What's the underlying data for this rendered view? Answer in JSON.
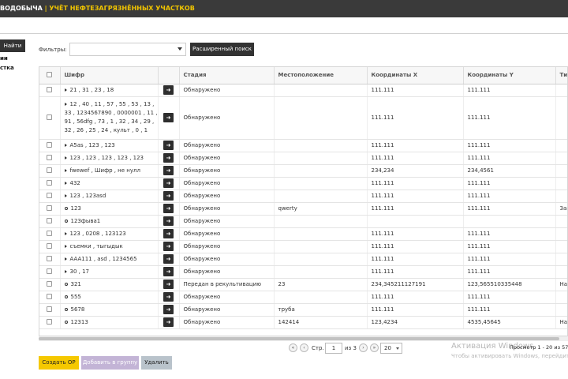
{
  "header": {
    "brand": "ВОДОБЫЧА",
    "separator": "|",
    "module_title": "УЧЁТ НЕФТЕЗАГРЯЗНЁННЫХ УЧАСТКОВ"
  },
  "sidebar": {
    "find_label": "Найти",
    "links": [
      "ии",
      "стка"
    ]
  },
  "filters": {
    "label": "Фильтры:",
    "value": "",
    "advanced_label": "Расширенный поиск"
  },
  "table": {
    "columns": [
      "Шифр",
      "Стадия",
      "Местоположение",
      "Координаты X",
      "Координаты Y",
      "Ти"
    ],
    "rows": [
      {
        "marker": "expand",
        "code": "21 , 31 , 23 , 18",
        "stage": "Обнаружено",
        "location": "",
        "x": "111.111",
        "y": "111.111",
        "type": "",
        "tall": false
      },
      {
        "marker": "expand",
        "code": "12 , 40 , 11 , 57 , 55 , 53 , 13 , 33 , 1234567890 , 0000001 , 11 , 91 , 56dfg , 73 , 1 , 32 , 34 , 29 , 32 , 26 , 25 , 24 , культ , 0 , 1",
        "stage": "Обнаружено",
        "location": "",
        "x": "111.111",
        "y": "111.111",
        "type": "",
        "tall": true
      },
      {
        "marker": "expand",
        "code": "A5as , 123 , 123",
        "stage": "Обнаружено",
        "location": "",
        "x": "111.111",
        "y": "111.111",
        "type": "",
        "tall": false
      },
      {
        "marker": "expand",
        "code": "123 , 123 , 123 , 123 , 123",
        "stage": "Обнаружено",
        "location": "",
        "x": "111.111",
        "y": "111.111",
        "type": "",
        "tall": false
      },
      {
        "marker": "expand",
        "code": "fwewef , Шифр , не нулл",
        "stage": "Обнаружено",
        "location": "",
        "x": "234,234",
        "y": "234,4561",
        "type": "",
        "tall": false
      },
      {
        "marker": "expand",
        "code": "432",
        "stage": "Обнаружено",
        "location": "",
        "x": "111.111",
        "y": "111.111",
        "type": "",
        "tall": false
      },
      {
        "marker": "expand",
        "code": "123 , 123asd",
        "stage": "Обнаружено",
        "location": "",
        "x": "111.111",
        "y": "111.111",
        "type": "",
        "tall": false
      },
      {
        "marker": "dot",
        "code": "123",
        "stage": "Обнаружено",
        "location": "qwerty",
        "x": "111.111",
        "y": "111.111",
        "type": "Загр",
        "tall": false
      },
      {
        "marker": "dot",
        "code": "123фыва1",
        "stage": "Обнаружено",
        "location": "",
        "x": "",
        "y": "",
        "type": "",
        "tall": false
      },
      {
        "marker": "expand",
        "code": "123 , 0208 , 123123",
        "stage": "Обнаружено",
        "location": "",
        "x": "111.111",
        "y": "111.111",
        "type": "",
        "tall": false
      },
      {
        "marker": "expand",
        "code": "съемки , тыгыдык",
        "stage": "Обнаружено",
        "location": "",
        "x": "111.111",
        "y": "111.111",
        "type": "",
        "tall": false
      },
      {
        "marker": "expand",
        "code": "AAA111 , asd , 1234565",
        "stage": "Обнаружено",
        "location": "",
        "x": "111.111",
        "y": "111.111",
        "type": "",
        "tall": false
      },
      {
        "marker": "expand",
        "code": "30 , 17",
        "stage": "Обнаружено",
        "location": "",
        "x": "111.111",
        "y": "111.111",
        "type": "",
        "tall": false
      },
      {
        "marker": "dot",
        "code": "321",
        "stage": "Передан в рекультивацию",
        "location": "23",
        "x": "234,345211127191",
        "y": "123,565510335448",
        "type": "Нар",
        "tall": false
      },
      {
        "marker": "dot",
        "code": "555",
        "stage": "Обнаружено",
        "location": "",
        "x": "111.111",
        "y": "111.111",
        "type": "",
        "tall": false
      },
      {
        "marker": "dot",
        "code": "5678",
        "stage": "Обнаружено",
        "location": "труба",
        "x": "111.111",
        "y": "111.111",
        "type": "",
        "tall": false
      },
      {
        "marker": "dot",
        "code": "12313",
        "stage": "Обнаружено",
        "location": "142414",
        "x": "123,4234",
        "y": "4535,45645",
        "type": "Нар",
        "tall": false
      }
    ]
  },
  "pager": {
    "page_label": "Стр.",
    "page_value": "1",
    "of_label": "из 3",
    "per_page": "20",
    "view_info": "Просмотр 1 - 20 из 57"
  },
  "watermark": {
    "line1": "Активация Windows",
    "line2": "Чтобы активировать Windows, перейдите в"
  },
  "actions": {
    "create_label": "Создать ОР",
    "group_label": "Добавить в группу",
    "delete_label": "Удалить"
  },
  "colors": {
    "topbar": "#3a3a3a",
    "accent_yellow": "#f5c800",
    "dark_button": "#333333"
  }
}
